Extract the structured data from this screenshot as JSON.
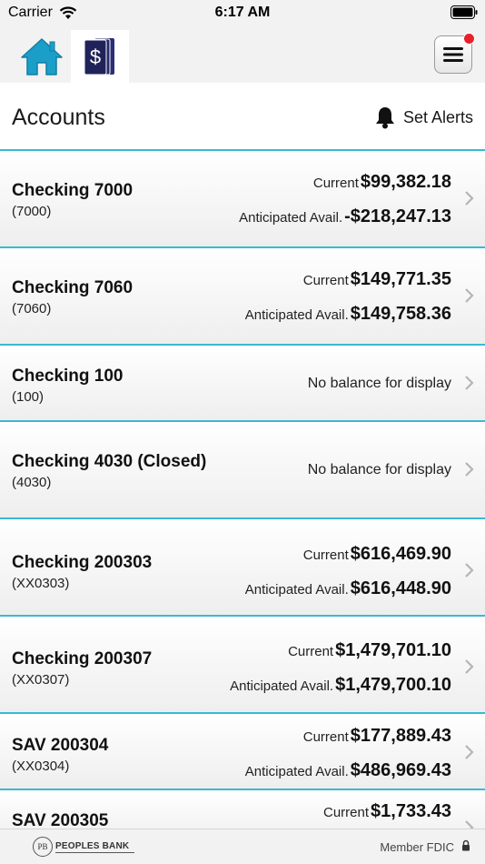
{
  "status_bar": {
    "carrier": "Carrier",
    "time": "6:17 AM"
  },
  "nav": {
    "home_icon": "home-icon",
    "accounts_icon": "dollar-cards-icon",
    "menu_icon": "hamburger-menu-icon",
    "notification": true
  },
  "header": {
    "title": "Accounts",
    "alerts_label": "Set Alerts"
  },
  "colors": {
    "accent": "#3bb8d4",
    "home_icon": "#1b9fc9",
    "accounts_icon": "#1f2359",
    "notification": "#e8202a"
  },
  "accounts": [
    {
      "name": "Checking 7000",
      "number": "(7000)",
      "current_label": "Current",
      "current": "$99,382.18",
      "avail_label": "Anticipated Avail.",
      "avail": "-$218,247.13"
    },
    {
      "name": "Checking 7060",
      "number": "(7060)",
      "current_label": "Current",
      "current": "$149,771.35",
      "avail_label": "Anticipated Avail.",
      "avail": "$149,758.36"
    },
    {
      "name": "Checking 100",
      "number": "(100)",
      "no_balance": "No balance for display"
    },
    {
      "name": "Checking 4030 (Closed)",
      "number": "(4030)",
      "no_balance": "No balance for display"
    },
    {
      "name": "Checking 200303",
      "number": "(XX0303)",
      "current_label": "Current",
      "current": "$616,469.90",
      "avail_label": "Anticipated Avail.",
      "avail": "$616,448.90"
    },
    {
      "name": "Checking 200307",
      "number": "(XX0307)",
      "current_label": "Current",
      "current": "$1,479,701.10",
      "avail_label": "Anticipated Avail.",
      "avail": "$1,479,700.10"
    },
    {
      "name": "SAV 200304",
      "number": "(XX0304)",
      "current_label": "Current",
      "current": "$177,889.43",
      "avail_label": "Anticipated Avail.",
      "avail": "$486,969.43"
    },
    {
      "name": "SAV 200305",
      "current_label": "Current",
      "current": "$1,733.43"
    }
  ],
  "footer": {
    "bank_name": "PEOPLES BANK",
    "logo_mark": "PB",
    "fdic": "Member FDIC"
  }
}
